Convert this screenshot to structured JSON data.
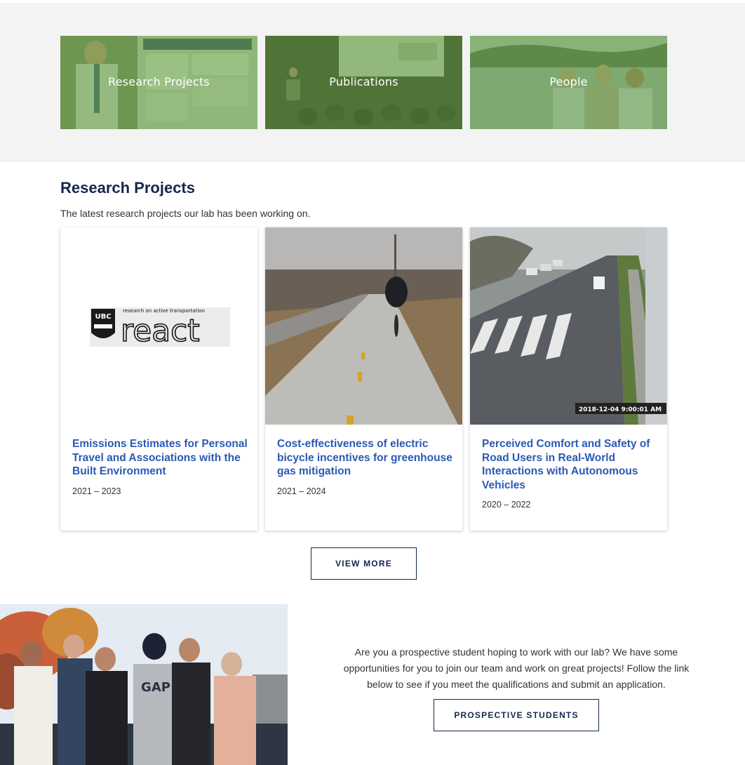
{
  "hero": {
    "tiles": [
      {
        "label": "Research Projects"
      },
      {
        "label": "Publications"
      },
      {
        "label": "People"
      }
    ]
  },
  "research": {
    "title": "Research Projects",
    "subtitle": "The latest research projects our lab has been working on.",
    "logo": {
      "tagline": "research on active transportation",
      "wordmark": "react",
      "badge": "UBC"
    },
    "cards": [
      {
        "title": "Emissions Estimates for Personal Travel and Associations with the Built Environment",
        "years": "2021 – 2023"
      },
      {
        "title": "Cost-effectiveness of electric bicycle incentives for greenhouse gas mitigation",
        "years": "2021 – 2024"
      },
      {
        "title": "Perceived Comfort and Safety of Road Users in Real-World Interactions with Autonomous Vehicles",
        "years": "2020 – 2022",
        "timestamp": "2018-12-04 9:00:01 AM"
      }
    ],
    "view_more": "VIEW MORE"
  },
  "prospective": {
    "text": "Are you a prospective student hoping to work with our lab? We have some opportunities for you to join our team and work on great projects! Follow the link below to see if you meet the qualifications and submit an application.",
    "button": "PROSPECTIVE STUDENTS",
    "shirt_text": "GAP"
  },
  "colors": {
    "navy": "#13284b",
    "link_blue": "#2b59b5",
    "tile_overlay": "#60a03c",
    "hero_bg": "#f3f3f3"
  }
}
